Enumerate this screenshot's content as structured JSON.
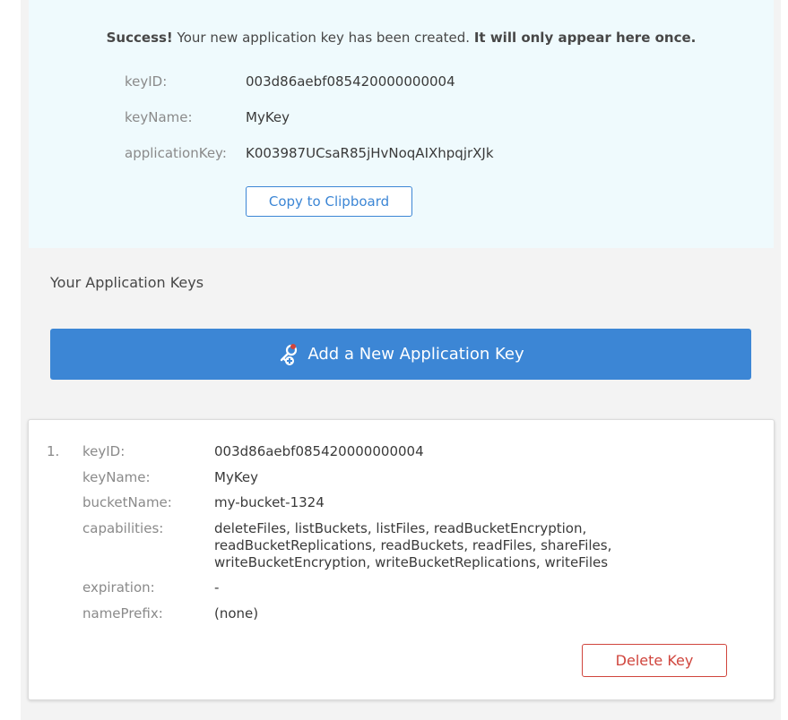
{
  "success": {
    "strong": "Success!",
    "message": " Your new application key has been created. ",
    "warning": "It will only appear here once.",
    "fields": {
      "keyID_label": "keyID:",
      "keyID_value": "003d86aebf085420000000004",
      "keyName_label": "keyName:",
      "keyName_value": "MyKey",
      "applicationKey_label": "applicationKey:",
      "applicationKey_value": "K003987UCsaR85jHvNoqAIXhpqjrXJk"
    },
    "copy_label": "Copy to Clipboard"
  },
  "section_title": "Your Application Keys",
  "add_button_label": "Add a New Application Key",
  "keys": [
    {
      "index": "1.",
      "keyID_label": "keyID:",
      "keyID": "003d86aebf085420000000004",
      "keyName_label": "keyName:",
      "keyName": "MyKey",
      "bucketName_label": "bucketName:",
      "bucketName": "my-bucket-1324",
      "capabilities_label": "capabilities:",
      "capabilities": "deleteFiles, listBuckets, listFiles, readBucketEncryption, readBucketReplications, readBuckets, readFiles, shareFiles, writeBucketEncryption, writeBucketReplications, writeFiles",
      "expiration_label": "expiration:",
      "expiration": "-",
      "namePrefix_label": "namePrefix:",
      "namePrefix": "(none)",
      "delete_label": "Delete Key"
    }
  ],
  "colors": {
    "accent": "#3c86d5",
    "success_bg": "#effafd",
    "danger": "#d0453d"
  },
  "icons": {
    "add_key": "key-plus-icon"
  }
}
